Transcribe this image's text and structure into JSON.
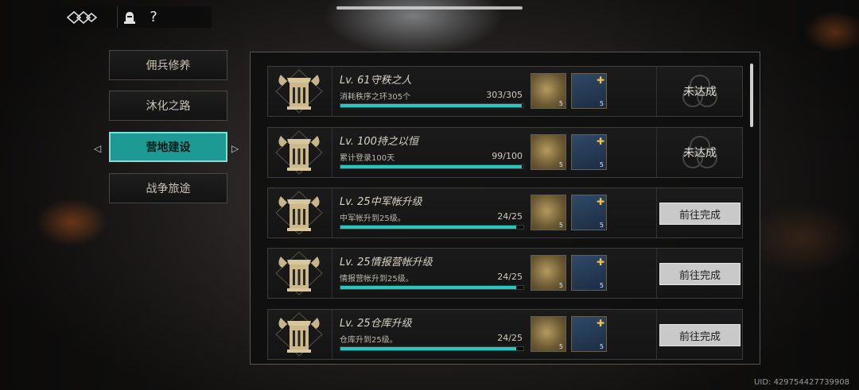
{
  "top_bar": {
    "help_label": "?"
  },
  "tabs": [
    {
      "label": "佣兵修养"
    },
    {
      "label": "沐化之路"
    },
    {
      "label": "营地建设"
    },
    {
      "label": "战争旅途"
    }
  ],
  "active_tab_index": 2,
  "accent_color": "#27c8c0",
  "tasks": [
    {
      "title": "Lv. 61守秩之人",
      "desc": "消耗秩序之环305个",
      "count": "303/305",
      "progress": 0.993,
      "items": [
        {
          "icon": "gold-ingot-item",
          "qty": "5"
        },
        {
          "icon": "wooden-crate-item",
          "qty": "5"
        }
      ],
      "status": "未达成",
      "action": null
    },
    {
      "title": "Lv. 100持之以恒",
      "desc": "累计登录100天",
      "count": "99/100",
      "progress": 0.99,
      "items": [
        {
          "icon": "gold-ingot-item",
          "qty": "5"
        },
        {
          "icon": "wooden-crate-item",
          "qty": "5"
        }
      ],
      "status": "未达成",
      "action": null
    },
    {
      "title": "Lv. 25中军帐升级",
      "desc": "中军帐升到25级。",
      "count": "24/25",
      "progress": 0.96,
      "items": [
        {
          "icon": "gold-ingot-item",
          "qty": "5"
        },
        {
          "icon": "wooden-crate-item",
          "qty": "5"
        }
      ],
      "status": null,
      "action": "前往完成"
    },
    {
      "title": "Lv. 25情报营帐升级",
      "desc": "情报营帐升到25级。",
      "count": "24/25",
      "progress": 0.96,
      "items": [
        {
          "icon": "gold-ingot-item",
          "qty": "5"
        },
        {
          "icon": "wooden-crate-item",
          "qty": "5"
        }
      ],
      "status": null,
      "action": "前往完成"
    },
    {
      "title": "Lv. 25仓库升级",
      "desc": "仓库升到25级。",
      "count": "24/25",
      "progress": 0.96,
      "items": [
        {
          "icon": "gold-ingot-item",
          "qty": "5"
        },
        {
          "icon": "wooden-crate-item",
          "qty": "5"
        }
      ],
      "status": null,
      "action": "前往完成"
    }
  ],
  "uid": "UID: 429754427739908"
}
